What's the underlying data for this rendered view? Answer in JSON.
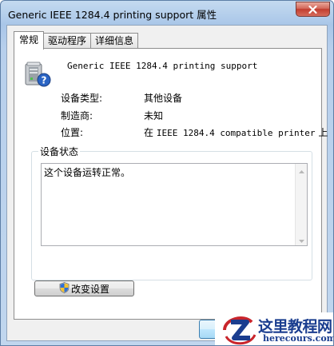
{
  "window": {
    "title": "Generic IEEE 1284.4 printing support 属性"
  },
  "tabs": [
    {
      "label": "常规",
      "active": true
    },
    {
      "label": "驱动程序",
      "active": false
    },
    {
      "label": "详细信息",
      "active": false
    }
  ],
  "device": {
    "name": "Generic IEEE 1284.4 printing support",
    "icon": "printer-device-unknown-icon",
    "properties": [
      {
        "label": "设备类型:",
        "value": "其他设备"
      },
      {
        "label": "制造商:",
        "value": "未知"
      },
      {
        "label": "位置:",
        "value_prefix": "在",
        "value_mono": "IEEE 1284.4 compatible printer",
        "value_suffix": "上"
      }
    ]
  },
  "status_group": {
    "legend": "设备状态",
    "text": "这个设备运转正常。"
  },
  "buttons": {
    "change_settings": "改变设置",
    "change_settings_icon": "uac-shield-icon"
  },
  "watermark": {
    "title": "这里教程网",
    "url": "herecours.com"
  },
  "colors": {
    "title_bar": "#b7cfec",
    "close_button": "#c23d2f",
    "watermark_blue": "#1a3d8f",
    "watermark_red": "#c9252c"
  }
}
